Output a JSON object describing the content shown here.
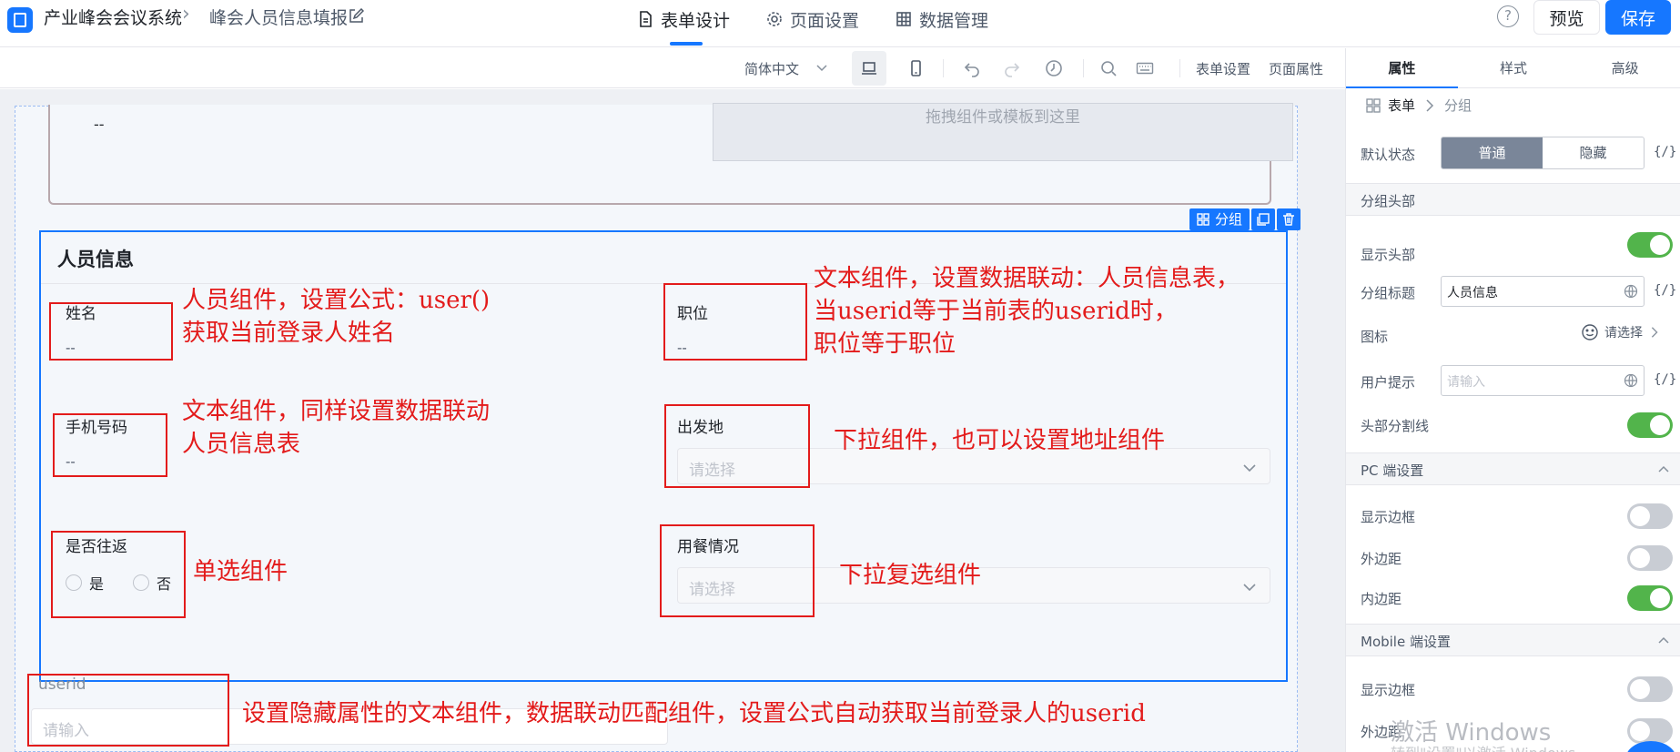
{
  "header": {
    "app_name": "产业峰会会议系统",
    "breadcrumb_sep": "›",
    "form_name": "峰会人员信息填报",
    "tabs": [
      {
        "label": "表单设计",
        "icon": "document-icon"
      },
      {
        "label": "页面设置",
        "icon": "gear-icon"
      },
      {
        "label": "数据管理",
        "icon": "table-icon"
      }
    ],
    "help": "?",
    "preview_label": "预览",
    "save_label": "保存"
  },
  "toolbar": {
    "language": "简体中文",
    "form_settings": "表单设置",
    "page_properties": "页面属性"
  },
  "canvas": {
    "prev_value": "--",
    "drop_hint": "拖拽组件或模板到这里",
    "group_tag": "分组",
    "group_title": "人员信息",
    "fields": {
      "name": {
        "label": "姓名",
        "value": "--"
      },
      "position": {
        "label": "职位",
        "value": "--"
      },
      "phone": {
        "label": "手机号码",
        "value": "--"
      },
      "departure": {
        "label": "出发地",
        "placeholder": "请选择"
      },
      "round_trip": {
        "label": "是否往返",
        "options": [
          "是",
          "否"
        ]
      },
      "meal": {
        "label": "用餐情况",
        "placeholder": "请选择"
      },
      "userid": {
        "label": "userid",
        "placeholder": "请输入"
      }
    }
  },
  "annotations": {
    "name_note_1": "人员组件，设置公式：user()",
    "name_note_2": "获取当前登录人姓名",
    "position_note_1": "文本组件，设置数据联动：人员信息表，",
    "position_note_2": "当userid等于当前表的userid时，",
    "position_note_3": "职位等于职位",
    "phone_note_1": "文本组件，同样设置数据联动",
    "phone_note_2": "人员信息表",
    "departure_note": "下拉组件，也可以设置地址组件",
    "radio_note": "单选组件",
    "meal_note": "下拉复选组件",
    "userid_note": "设置隐藏属性的文本组件，数据联动匹配组件，设置公式自动获取当前登录人的userid"
  },
  "panel": {
    "tabs": [
      "属性",
      "样式",
      "高级"
    ],
    "crumb_root": "表单",
    "crumb_current": "分组",
    "default_state_label": "默认状态",
    "state_options": [
      "普通",
      "隐藏"
    ],
    "fx": "{/}",
    "section_header": "分组头部",
    "show_header_label": "显示头部",
    "group_title_label": "分组标题",
    "group_title_value": "人员信息",
    "icon_label": "图标",
    "icon_pick": "请选择",
    "user_tip_label": "用户提示",
    "user_tip_placeholder": "请输入",
    "header_divider_label": "头部分割线",
    "pc_section": "PC 端设置",
    "show_border_label": "显示边框",
    "margin_label": "外边距",
    "padding_label": "内边距",
    "mobile_section": "Mobile 端设置",
    "mobile_show_border_label": "显示边框",
    "mobile_margin_label": "外边距"
  },
  "toggles": {
    "show_header": true,
    "header_divider": true,
    "pc_show_border": false,
    "pc_margin": false,
    "pc_padding": true,
    "mobile_show_border": false,
    "mobile_margin": false
  },
  "watermark": {
    "line1": "激活 Windows",
    "line2": "转到\"设置\"以激活 Windows。"
  },
  "colors": {
    "accent": "#1677ff",
    "annotation": "#e31b1b",
    "toggle_on": "#52b44b"
  }
}
